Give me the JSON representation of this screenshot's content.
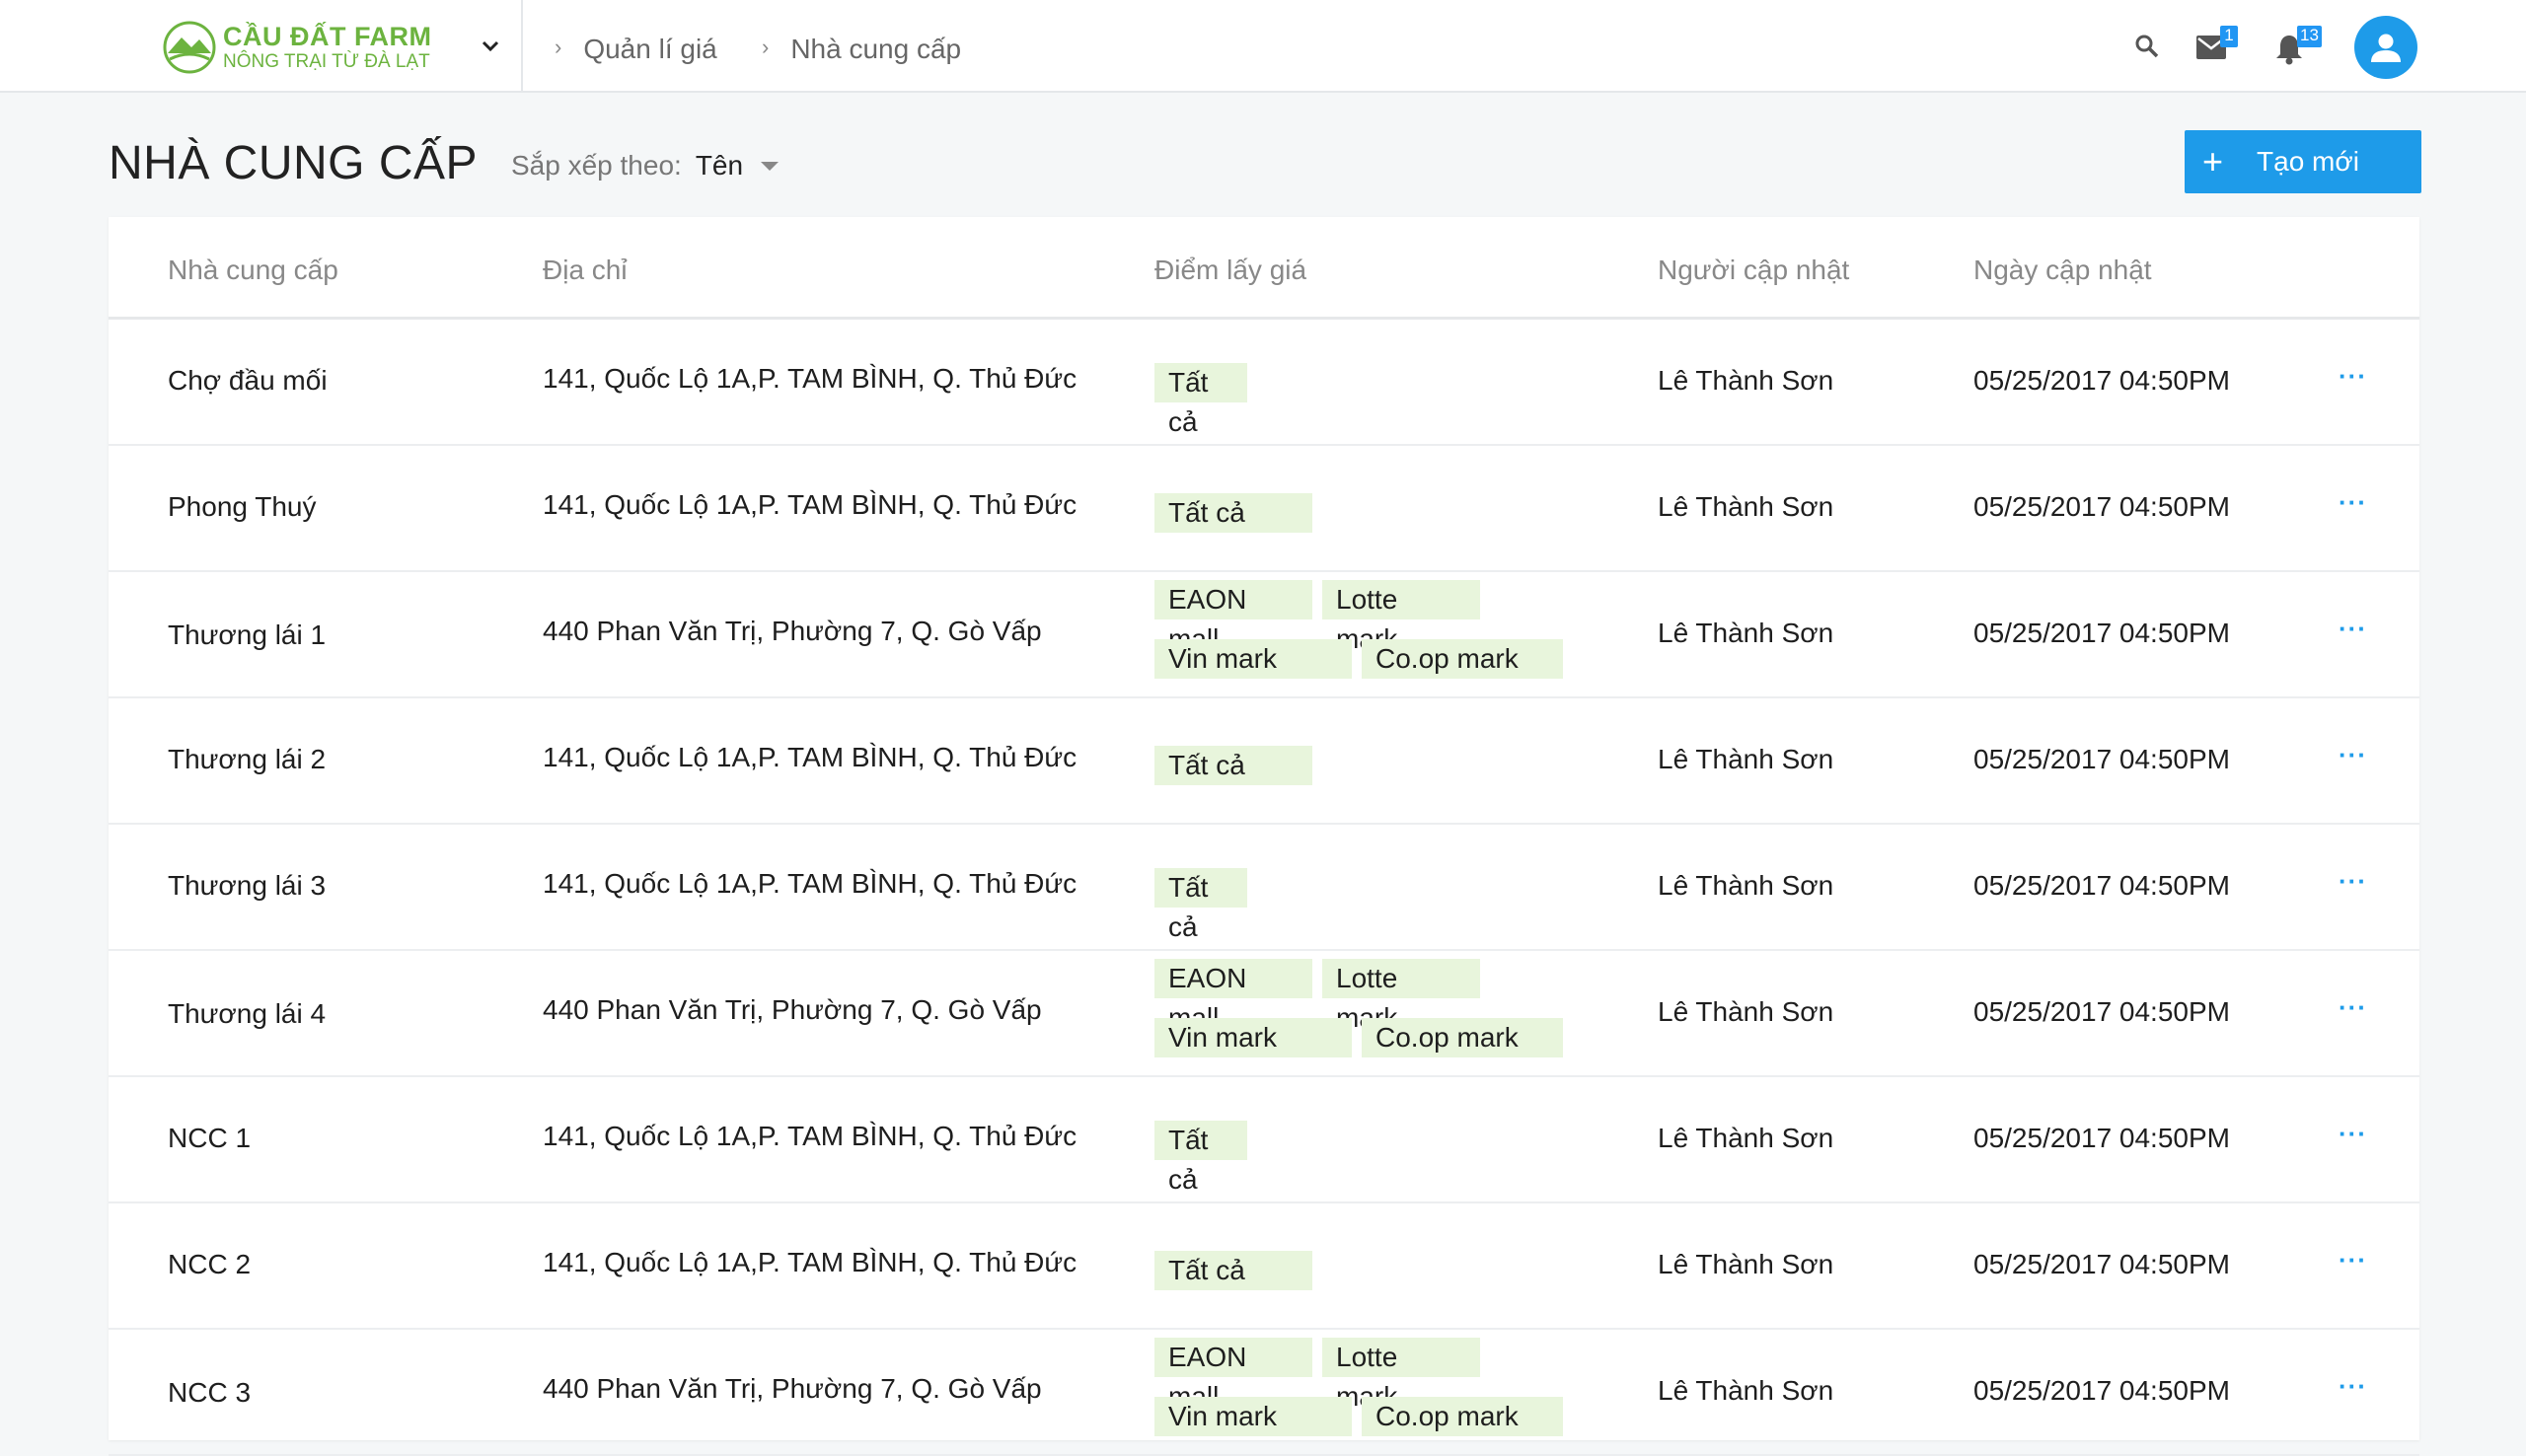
{
  "header": {
    "brand": "CẦU ĐẤT FARM",
    "tagline": "NÔNG TRẠI TỪ ĐÀ LẠT",
    "breadcrumbs": [
      "Quản lí giá",
      "Nhà cung cấp"
    ],
    "mail_count": "1",
    "notification_count": "13",
    "accent_color": "#1e9be9",
    "brand_color": "#6cb33f"
  },
  "page": {
    "title": "NHÀ CUNG CẤP",
    "sort_label": "Sắp xếp theo:",
    "sort_value": "Tên",
    "create_label": "Tạo mới"
  },
  "table": {
    "columns": [
      "Nhà cung cấp",
      "Địa chỉ",
      "Điểm lấy giá",
      "Người cập nhật",
      "Ngày cập nhật"
    ],
    "rows": [
      {
        "name": "Chợ đầu mối",
        "address": "141, Quốc Lộ 1A,P. TAM BÌNH, Q. Thủ Đức",
        "tags": [
          "Tất cả"
        ],
        "user": "Lê Thành Sơn",
        "date": "05/25/2017  04:50PM"
      },
      {
        "name": "Phong Thuý",
        "address": "141, Quốc Lộ 1A,P. TAM BÌNH, Q. Thủ Đức",
        "tags": [
          "Tất cả"
        ],
        "user": "Lê Thành Sơn",
        "date": "05/25/2017  04:50PM"
      },
      {
        "name": "Thương lái 1",
        "address": "440 Phan Văn Trị, Phường 7, Q. Gò Vấp",
        "tags": [
          "EAON mall",
          "Lotte mark",
          "Vin mark",
          "Co.op mark"
        ],
        "user": "Lê Thành Sơn",
        "date": "05/25/2017  04:50PM"
      },
      {
        "name": "Thương lái 2",
        "address": "141, Quốc Lộ 1A,P. TAM BÌNH, Q. Thủ Đức",
        "tags": [
          "Tất cả"
        ],
        "user": "Lê Thành Sơn",
        "date": "05/25/2017  04:50PM"
      },
      {
        "name": "Thương lái 3",
        "address": "141, Quốc Lộ 1A,P. TAM BÌNH, Q. Thủ Đức",
        "tags": [
          "Tất cả"
        ],
        "user": "Lê Thành Sơn",
        "date": "05/25/2017  04:50PM"
      },
      {
        "name": "Thương lái 4",
        "address": "440 Phan Văn Trị, Phường 7, Q. Gò Vấp",
        "tags": [
          "EAON mall",
          "Lotte mark",
          "Vin mark",
          "Co.op mark"
        ],
        "user": "Lê Thành Sơn",
        "date": "05/25/2017  04:50PM"
      },
      {
        "name": "NCC 1",
        "address": "141, Quốc Lộ 1A,P. TAM BÌNH, Q. Thủ Đức",
        "tags": [
          "Tất cả"
        ],
        "user": "Lê Thành Sơn",
        "date": "05/25/2017  04:50PM"
      },
      {
        "name": "NCC 2",
        "address": "141, Quốc Lộ 1A,P. TAM BÌNH, Q. Thủ Đức",
        "tags": [
          "Tất cả"
        ],
        "user": "Lê Thành Sơn",
        "date": "05/25/2017  04:50PM"
      },
      {
        "name": "NCC 3",
        "address": "440 Phan Văn Trị, Phường 7, Q. Gò Vấp",
        "tags": [
          "EAON mall",
          "Lotte mark",
          "Vin mark",
          "Co.op mark"
        ],
        "user": "Lê Thành Sơn",
        "date": "05/25/2017  04:50PM"
      }
    ],
    "more_label": "···"
  }
}
